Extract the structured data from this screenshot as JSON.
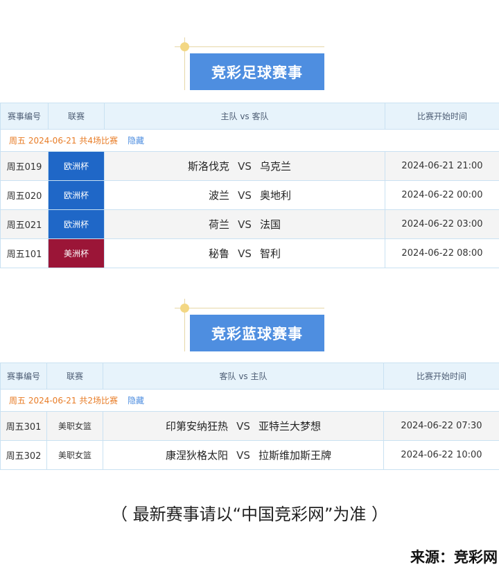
{
  "football": {
    "title": "竞彩足球赛事",
    "headers": [
      "赛事编号",
      "联赛",
      "主队 vs 客队",
      "比赛开始时间"
    ],
    "summary": "周五 2024-06-21 共4场比赛",
    "hide_label": "隐藏",
    "rows": [
      {
        "id": "周五019",
        "league": "欧洲杯",
        "home": "斯洛伐克",
        "vs": "VS",
        "away": "乌克兰",
        "time": "2024-06-21 21:00"
      },
      {
        "id": "周五020",
        "league": "欧洲杯",
        "home": "波兰",
        "vs": "VS",
        "away": "奥地利",
        "time": "2024-06-22 00:00"
      },
      {
        "id": "周五021",
        "league": "欧洲杯",
        "home": "荷兰",
        "vs": "VS",
        "away": "法国",
        "time": "2024-06-22 03:00"
      },
      {
        "id": "周五101",
        "league": "美洲杯",
        "home": "秘鲁",
        "vs": "VS",
        "away": "智利",
        "time": "2024-06-22 08:00"
      }
    ]
  },
  "basketball": {
    "title": "竞彩蓝球赛事",
    "headers": [
      "赛事编号",
      "联赛",
      "客队 vs 主队",
      "比赛开始时间"
    ],
    "summary": "周五 2024-06-21 共2场比赛",
    "hide_label": "隐藏",
    "rows": [
      {
        "id": "周五301",
        "league": "美职女篮",
        "home": "印第安纳狂热",
        "vs": "VS",
        "away": "亚特兰大梦想",
        "time": "2024-06-22 07:30"
      },
      {
        "id": "周五302",
        "league": "美职女篮",
        "home": "康涅狄格太阳",
        "vs": "VS",
        "away": "拉斯维加斯王牌",
        "time": "2024-06-22 10:00"
      }
    ]
  },
  "note": "（ 最新赛事请以“中国竞彩网”为准 ）",
  "source": "来源：竞彩网",
  "colors": {
    "accent": "#4e8ee0",
    "euro_league": "#1f67c7",
    "america_league": "#9b1537",
    "summary_text": "#e87c26"
  }
}
